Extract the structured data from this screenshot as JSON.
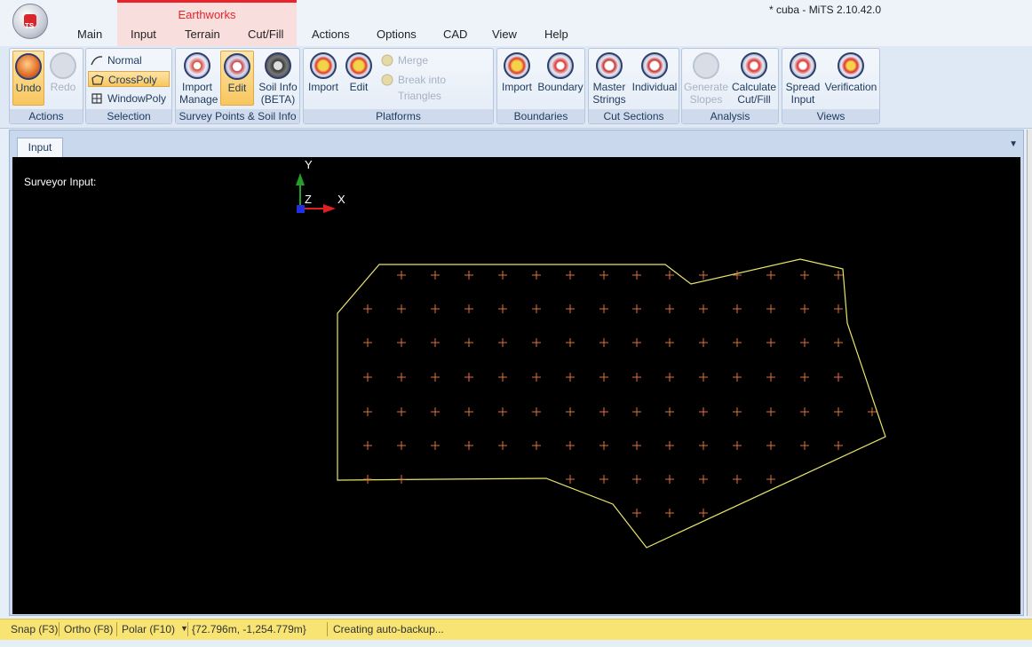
{
  "window": {
    "title": "* cuba - MiTS 2.10.42.0"
  },
  "context_group": {
    "label": "Earthworks"
  },
  "tabs": [
    {
      "label": "Main"
    },
    {
      "label": "Input"
    },
    {
      "label": "Terrain"
    },
    {
      "label": "Cut/Fill"
    },
    {
      "label": "Actions"
    },
    {
      "label": "Options"
    },
    {
      "label": "CAD"
    },
    {
      "label": "View"
    },
    {
      "label": "Help"
    }
  ],
  "ribbon": {
    "actions": {
      "label": "Actions",
      "undo": "Undo",
      "redo": "Redo"
    },
    "selection": {
      "label": "Selection",
      "normal": "Normal",
      "crosspoly": "CrossPoly",
      "windowpoly": "WindowPoly"
    },
    "survey": {
      "label": "Survey Points & Soil Info",
      "import_line1": "Import",
      "import_line2": "Manage",
      "edit": "Edit",
      "soil_line1": "Soil Info",
      "soil_line2": "(BETA)"
    },
    "platforms": {
      "label": "Platforms",
      "import": "Import",
      "edit": "Edit",
      "merge": "Merge",
      "break": "Break into Triangles"
    },
    "boundaries": {
      "label": "Boundaries",
      "import": "Import",
      "boundary": "Boundary"
    },
    "cut_sections": {
      "label": "Cut Sections",
      "master_line1": "Master",
      "master_line2": "Strings",
      "individual": "Individual"
    },
    "analysis": {
      "label": "Analysis",
      "gen_line1": "Generate",
      "gen_line2": "Slopes",
      "calc_line1": "Calculate",
      "calc_line2": "Cut/Fill"
    },
    "views": {
      "label": "Views",
      "spread_line1": "Spread",
      "spread_line2": "Input",
      "verification": "Verification"
    }
  },
  "document": {
    "tab": "Input",
    "surveyor_label": "Surveyor Input:"
  },
  "axes": {
    "y": "Y",
    "z": "Z",
    "x": "X"
  },
  "status": {
    "snap": "Snap (F3)",
    "ortho": "Ortho (F8)",
    "polar": "Polar (F10)",
    "coords": "{72.796m, -1,254.779m}",
    "message": "Creating auto-backup..."
  },
  "colors": {
    "boundary": "#e8e56a",
    "points": "#e0703c",
    "status_bg": "#f7e472",
    "accent": "#e8242a"
  }
}
